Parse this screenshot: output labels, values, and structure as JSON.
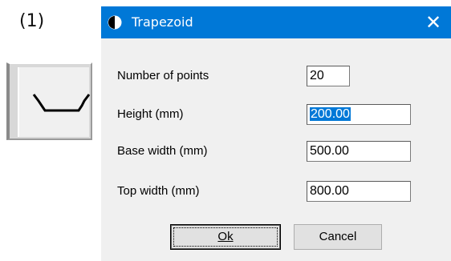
{
  "step_label": "(1)",
  "tool_icon": "trapezoid-channel-icon",
  "dialog": {
    "title": "Trapezoid",
    "title_icon": "half-circle-icon",
    "close_label": "✕",
    "fields": [
      {
        "label": "Number of points",
        "value": "20"
      },
      {
        "label": "Height (mm)",
        "value": "200.00"
      },
      {
        "label": "Base width (mm)",
        "value": "500.00"
      },
      {
        "label": "Top width (mm)",
        "value": "800.00"
      }
    ],
    "ok_label": "Ok",
    "cancel_label": "Cancel"
  },
  "colors": {
    "titlebar": "#0078d7",
    "dialog_bg": "#f0f0f0",
    "selection": "#0078d7"
  }
}
